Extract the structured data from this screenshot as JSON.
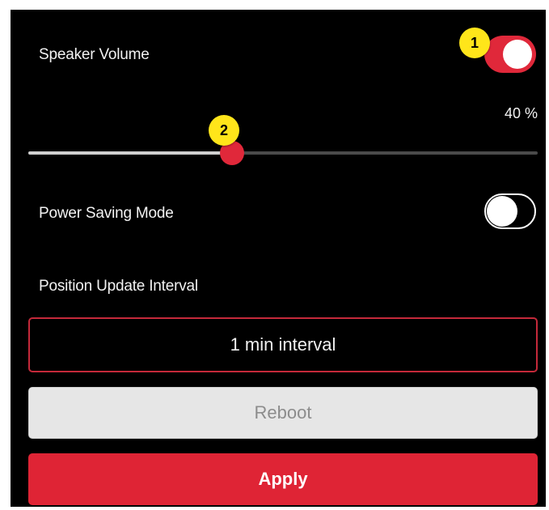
{
  "speaker": {
    "label": "Speaker Volume",
    "enabled": true,
    "badge": "1"
  },
  "volume": {
    "percent_text": "40 %",
    "value": 40,
    "badge": "2"
  },
  "power_saving": {
    "label": "Power Saving Mode",
    "enabled": false
  },
  "position_update": {
    "label": "Position Update Interval",
    "selected": "1 min interval"
  },
  "buttons": {
    "reboot": "Reboot",
    "apply": "Apply"
  },
  "colors": {
    "accent": "#e0283a",
    "badge": "#ffe51a",
    "background": "#000000"
  }
}
